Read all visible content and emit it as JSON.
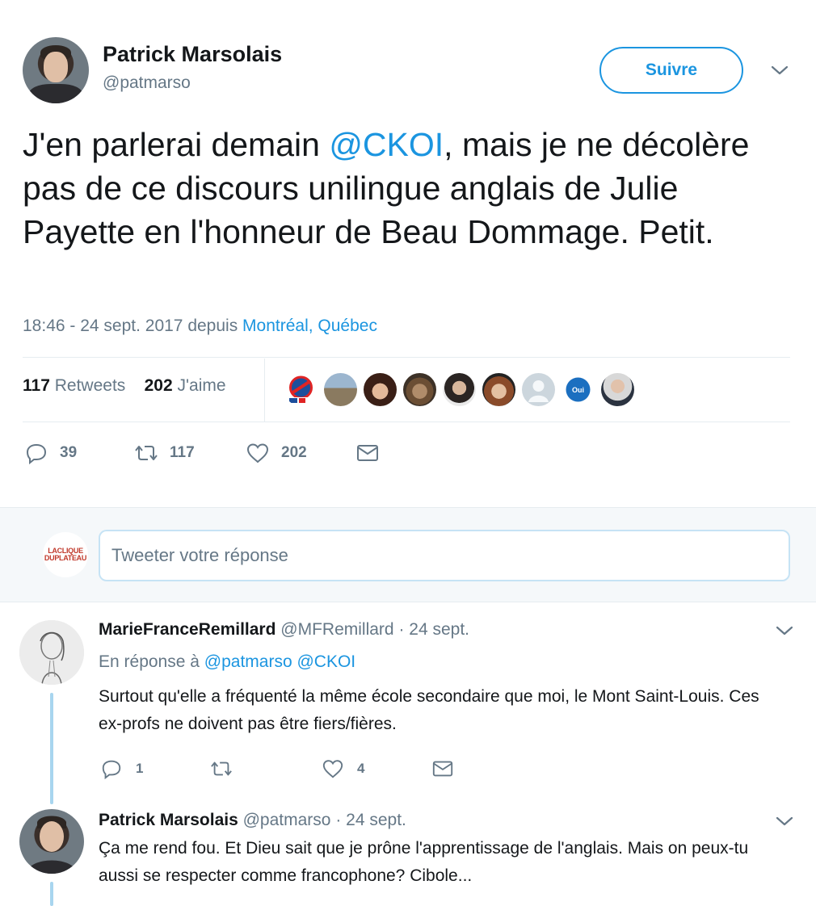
{
  "tweet": {
    "author_name": "Patrick Marsolais",
    "author_handle": "@patmarso",
    "follow_label": "Suivre",
    "text_part1": "J'en parlerai demain ",
    "mention": "@CKOI",
    "text_part2": ", mais je ne décolère pas de ce discours unilingue anglais de Julie Payette en l'honneur de Beau Dommage. Petit.",
    "timestamp": "18:46 - 24 sept. 2017 depuis ",
    "location": "Montréal, Québec",
    "retweets_count": "117",
    "retweets_label": "Retweets",
    "likes_count": "202",
    "likes_label": "J'aime",
    "actions": {
      "reply_count": "39",
      "retweet_count": "117",
      "like_count": "202"
    }
  },
  "composer": {
    "placeholder": "Tweeter votre réponse",
    "avatar_line1": "LACLIQUE",
    "avatar_line2": "DUPLATEAU"
  },
  "replies": [
    {
      "name": "MarieFranceRemillard",
      "handle": "@MFRemillard",
      "date": "· 24 sept.",
      "reply_to_label": "En réponse à",
      "reply_to_1": "@patmarso",
      "reply_to_2": "@CKOI",
      "text": "Surtout qu'elle a fréquenté la même école secondaire que moi, le Mont Saint-Louis. Ces ex-profs ne doivent pas être fiers/fières.",
      "reply_count": "1",
      "retweet_count": "",
      "like_count": "4"
    },
    {
      "name": "Patrick Marsolais",
      "handle": "@patmarso",
      "date": "· 24 sept.",
      "text": "Ça me rend fou. Et Dieu sait que je prône l'apprentissage de l'anglais. Mais on peux-tu aussi se respecter comme francophone? Cibole..."
    }
  ],
  "icons": {
    "reply": "reply-icon",
    "retweet": "retweet-icon",
    "like": "heart-icon",
    "dm": "envelope-icon",
    "caret": "chevron-down-icon"
  },
  "colors": {
    "accent": "#1b95e0",
    "muted": "#657786",
    "text": "#14171a",
    "thread_line": "#a8d5ef"
  }
}
